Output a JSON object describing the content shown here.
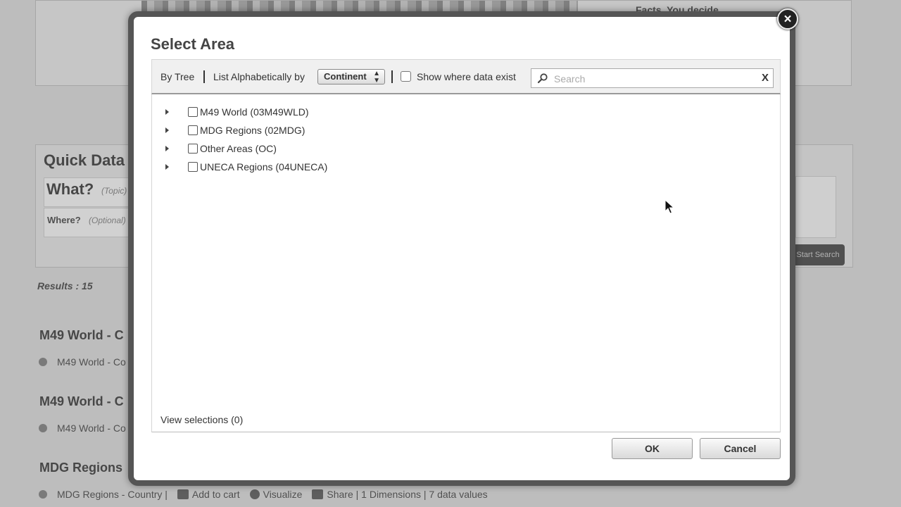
{
  "background": {
    "tagline": "Facts. You decide",
    "quick_title": "Quick Data",
    "what_label": "What?",
    "what_hint": "(Topic)",
    "where_label": "Where?",
    "where_hint": "(Optional)",
    "search_button": "Start Search",
    "results": "Results : 15",
    "groups": [
      {
        "heading": "M49 World - C",
        "item": "M49 World - Co"
      },
      {
        "heading": "M49 World - C",
        "item": "M49 World - Co"
      },
      {
        "heading": "MDG Regions",
        "item": "MDG Regions - Country |"
      }
    ],
    "actions": {
      "add_to_cart": "Add to cart",
      "visualize": "Visualize",
      "share": "Share | 1 Dimensions | 7 data values"
    }
  },
  "dialog": {
    "title": "Select Area",
    "close_symbol": "×",
    "toolbar": {
      "by_tree": "By Tree",
      "list_alpha": "List Alphabetically by",
      "sort_select": "Continent",
      "show_where": "Show where data exist",
      "search_placeholder": "Search",
      "clear_symbol": "X"
    },
    "tree": [
      {
        "label": "M49 World (03M49WLD)"
      },
      {
        "label": "MDG Regions (02MDG)"
      },
      {
        "label": "Other Areas (OC)"
      },
      {
        "label": "UNECA Regions (04UNECA)"
      }
    ],
    "view_selections": "View selections (0)",
    "ok": "OK",
    "cancel": "Cancel"
  }
}
